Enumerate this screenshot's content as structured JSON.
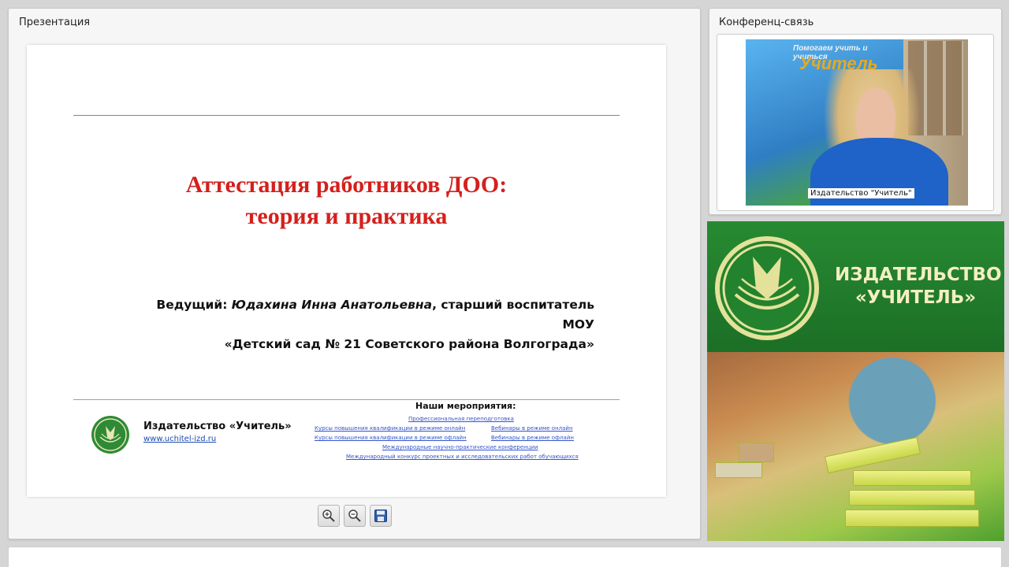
{
  "presentation": {
    "title": "Презентация",
    "slide": {
      "title_line1": "Аттестация работников ДОО:",
      "title_line2": "теория и практика",
      "presenter_label": "Ведущий: ",
      "presenter_name": "Юдахина Инна Анатольевна",
      "presenter_role": ", старший воспитатель МОУ",
      "presenter_org": "«Детский сад № 21 Советского района Волгограда»",
      "publisher": "Издательство «Учитель»",
      "url": "www.uchitel-izd.ru",
      "events_title": "Наши мероприятия:",
      "events": [
        "Профессиональная переподготовка",
        "Курсы повышения квалификации в режиме онлайн",
        "Вебинары в режиме онлайн",
        "Курсы повышения квалификации в режиме офлайн",
        "Вебинары в режиме офлайн",
        "Международные научно-практические конференции",
        "Международный конкурс проектных и исследовательских работ обучающихся"
      ]
    },
    "toolbar": {
      "zoom_in_icon": "zoom-in-icon",
      "zoom_out_icon": "zoom-out-icon",
      "save_icon": "floppy-disk-icon"
    }
  },
  "conference": {
    "title": "Конференц-связь",
    "video_label": "Издательство \"Учитель\"",
    "video_banner_text": "Помогаем учить и учиться",
    "video_banner_brand": "Учитель"
  },
  "brand": {
    "name_line1": "ИЗДАТЕЛЬСТВО",
    "name_line2": "«УЧИТЕЛЬ»",
    "colors": {
      "green": "#1e7a2a",
      "cream": "#f4efc0",
      "red": "#d4201d"
    }
  }
}
